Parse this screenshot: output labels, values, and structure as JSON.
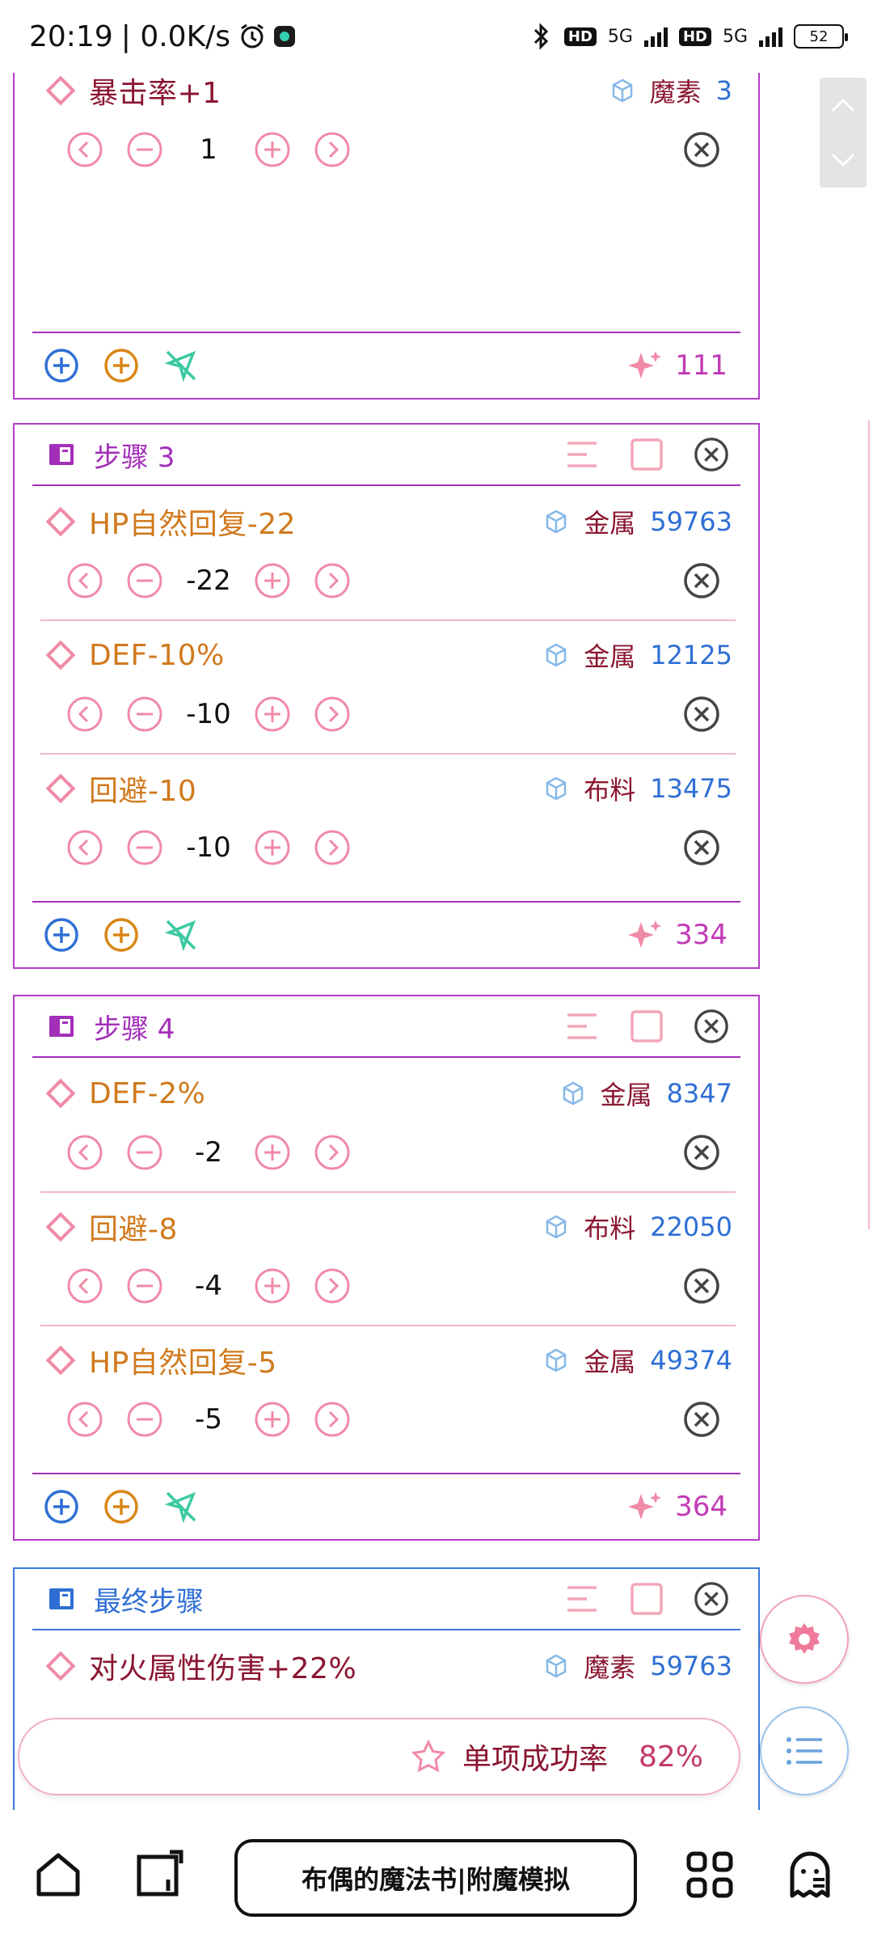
{
  "status_bar": {
    "time": "20:19",
    "speed": "| 0.0K/s",
    "network1": "5G",
    "network2": "5G",
    "hd": "HD",
    "battery": "52"
  },
  "partial_card": {
    "item": {
      "name": "暴击率+1",
      "material": "魔素",
      "count": "3",
      "qty": "1"
    },
    "score": "111"
  },
  "step3": {
    "title": "步骤 3",
    "items": [
      {
        "name": "HP自然回复-22",
        "material": "金属",
        "count": "59763",
        "qty": "-22"
      },
      {
        "name": "DEF-10%",
        "material": "金属",
        "count": "12125",
        "qty": "-10"
      },
      {
        "name": "回避-10",
        "material": "布料",
        "count": "13475",
        "qty": "-10"
      }
    ],
    "score": "334"
  },
  "step4": {
    "title": "步骤 4",
    "items": [
      {
        "name": "DEF-2%",
        "material": "金属",
        "count": "8347",
        "qty": "-2"
      },
      {
        "name": "回避-8",
        "material": "布料",
        "count": "22050",
        "qty": "-4"
      },
      {
        "name": "HP自然回复-5",
        "material": "金属",
        "count": "49374",
        "qty": "-5"
      }
    ],
    "score": "364"
  },
  "final_step": {
    "title": "最终步骤",
    "items": [
      {
        "name": "对火属性伤害+22%",
        "material": "魔素",
        "count": "59763"
      }
    ]
  },
  "success": {
    "label": "单项成功率",
    "value": "82%"
  },
  "nav": {
    "title": "布偶的魔法书|附魔模拟"
  },
  "icons": {
    "item": "diamond-icon",
    "material": "cube-icon",
    "prev": "chevron-left-circle-icon",
    "minus": "minus-circle-icon",
    "plus": "plus-circle-icon",
    "next": "chevron-right-circle-icon",
    "remove": "close-circle-icon",
    "score": "sparkle-icon"
  },
  "colors": {
    "step_border": "#b23bc7",
    "final_border": "#3a78d8",
    "item_name": "#d07a1e",
    "material": "#8a1530",
    "count": "#2f6fd4",
    "control_pink": "#f08aa6",
    "score": "#c23ab6"
  }
}
